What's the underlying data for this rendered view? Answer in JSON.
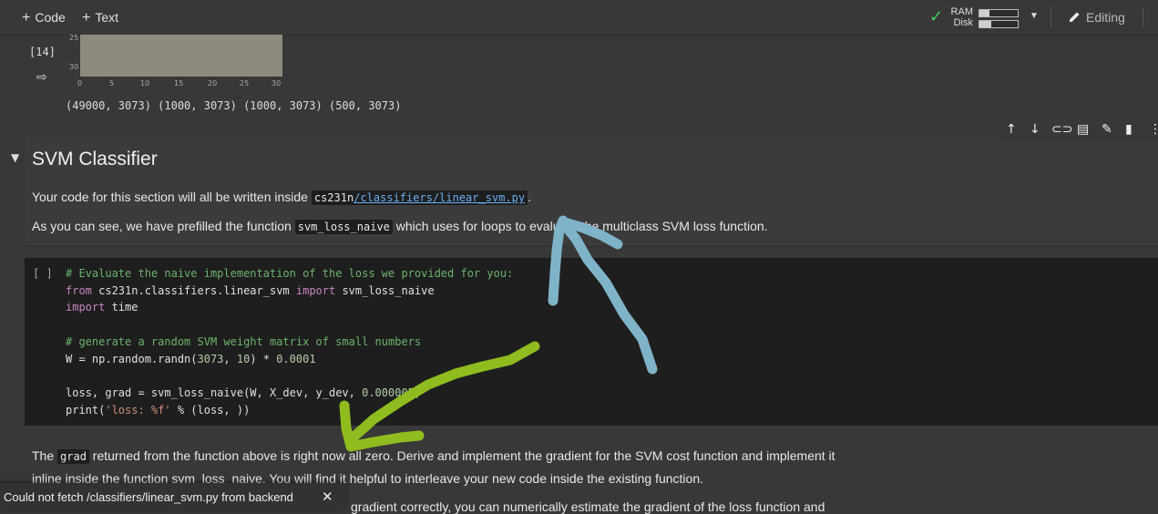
{
  "toolbar": {
    "add_code": "Code",
    "add_text": "Text",
    "ram_label": "RAM",
    "disk_label": "Disk",
    "ram_fraction": 0.25,
    "disk_fraction": 0.3,
    "editing_label": "Editing"
  },
  "prev_output": {
    "exec_count": "[14]",
    "ticks_y": [
      "25",
      "30"
    ],
    "ticks_x": [
      "0",
      "5",
      "10",
      "15",
      "20",
      "25",
      "30"
    ],
    "shapes_text": "(49000, 3073) (1000, 3073) (1000, 3073) (500, 3073)"
  },
  "markdown": {
    "heading": "SVM Classifier",
    "p1_before": "Your code for this section will all be written inside ",
    "p1_code_prefix": "cs231n",
    "p1_link": "/classifiers/linear_svm.py",
    "p1_after": ".",
    "p2_before": "As you can see, we have prefilled the function ",
    "p2_code": "svm_loss_naive",
    "p2_after": " which uses for loops to evaluate the multiclass SVM loss function."
  },
  "code_cell": {
    "run_label": "[ ]",
    "lines": [
      "# Evaluate the naive implementation of the loss we provided for you:",
      "from cs231n.classifiers.linear_svm import svm_loss_naive",
      "import time",
      "",
      "# generate a random SVM weight matrix of small numbers",
      "W = np.random.randn(3073, 10) * 0.0001",
      "",
      "loss, grad = svm_loss_naive(W, X_dev, y_dev, 0.000005)",
      "print('loss: %f' % (loss, ))"
    ]
  },
  "text_below": {
    "p3_before": "The ",
    "p3_code": "grad",
    "p3_after": " returned from the function above is right now all zero. Derive and implement the gradient for the SVM cost function and implement it",
    "p4": "inline inside the function svm_loss_naive. You will find it helpful to interleave your new code inside the existing function.",
    "p5": "gradient correctly, you can numerically estimate the gradient of the loss function and"
  },
  "toast": {
    "message": "Could not fetch /classifiers/linear_svm.py from backend"
  },
  "colors": {
    "background": "#383838",
    "code_bg": "#1e1e1e",
    "link": "#6ab0f3",
    "annotation_blue": "#7fb3c8",
    "annotation_green": "#8fbc1e"
  }
}
